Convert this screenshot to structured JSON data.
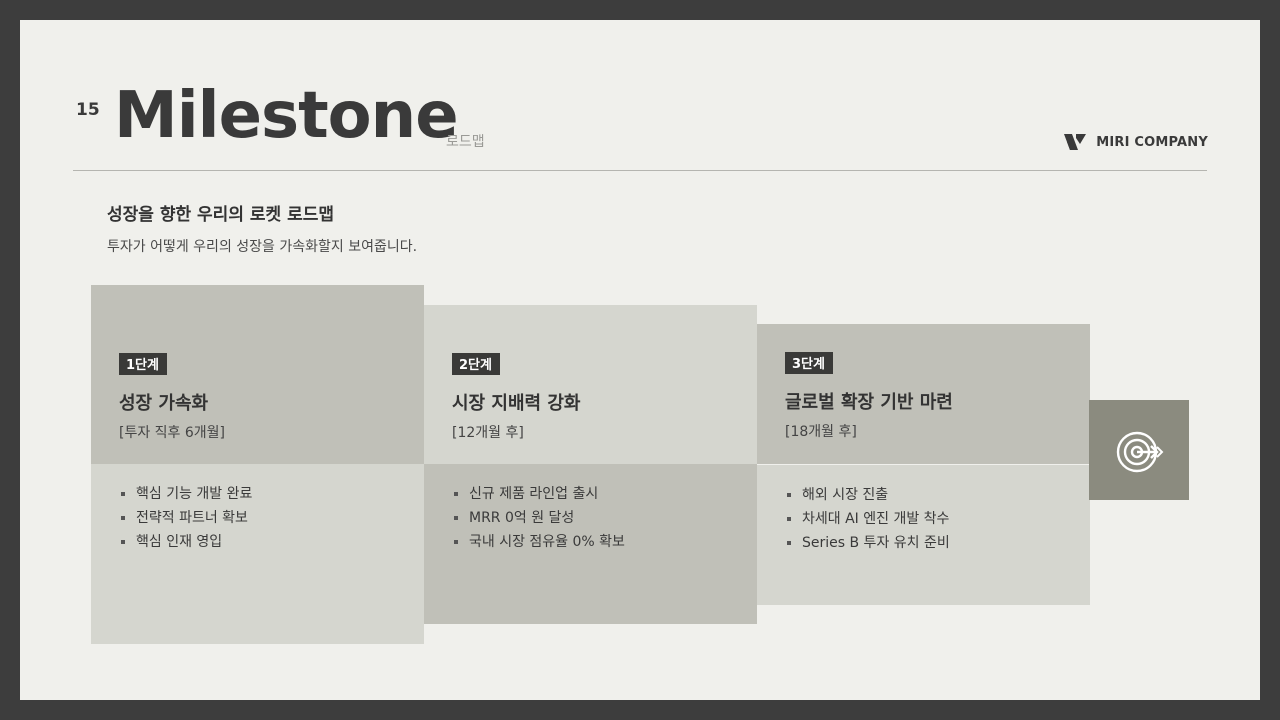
{
  "page_number": "15",
  "title": "Milestone",
  "subtitle": "로드맵",
  "company": {
    "name": "MIRI COMPANY",
    "logo_icon": "miri-logo-icon"
  },
  "heading": "성장을 향한 우리의 로켓 로드맵",
  "description": "투자가 어떻게 우리의 성장을 가속화할지 보여줍니다.",
  "steps": [
    {
      "badge": "1단계",
      "title": "성장 가속화",
      "period": "[투자 직후 6개월]",
      "items": [
        "핵심 기능 개발 완료",
        "전략적 파트너 확보",
        "핵심 인재 영입"
      ]
    },
    {
      "badge": "2단계",
      "title": "시장 지배력 강화",
      "period": "[12개월 후]",
      "items": [
        "신규 제품 라인업 출시",
        "MRR 0억 원 달성",
        "국내 시장 점유율 0% 확보"
      ]
    },
    {
      "badge": "3단계",
      "title": "글로벌 확장 기반 마련",
      "period": "[18개월 후]",
      "items": [
        "해외 시장 진출",
        "차세대 AI 엔진 개발 착수",
        "Series B 투자 유치 준비"
      ]
    }
  ],
  "goal_icon": "target-icon",
  "colors": {
    "badge": "#3a3a38",
    "goal_box": "#8b8b7f",
    "tone_dark": "#c0c0b8",
    "tone_light": "#d5d6cf"
  }
}
